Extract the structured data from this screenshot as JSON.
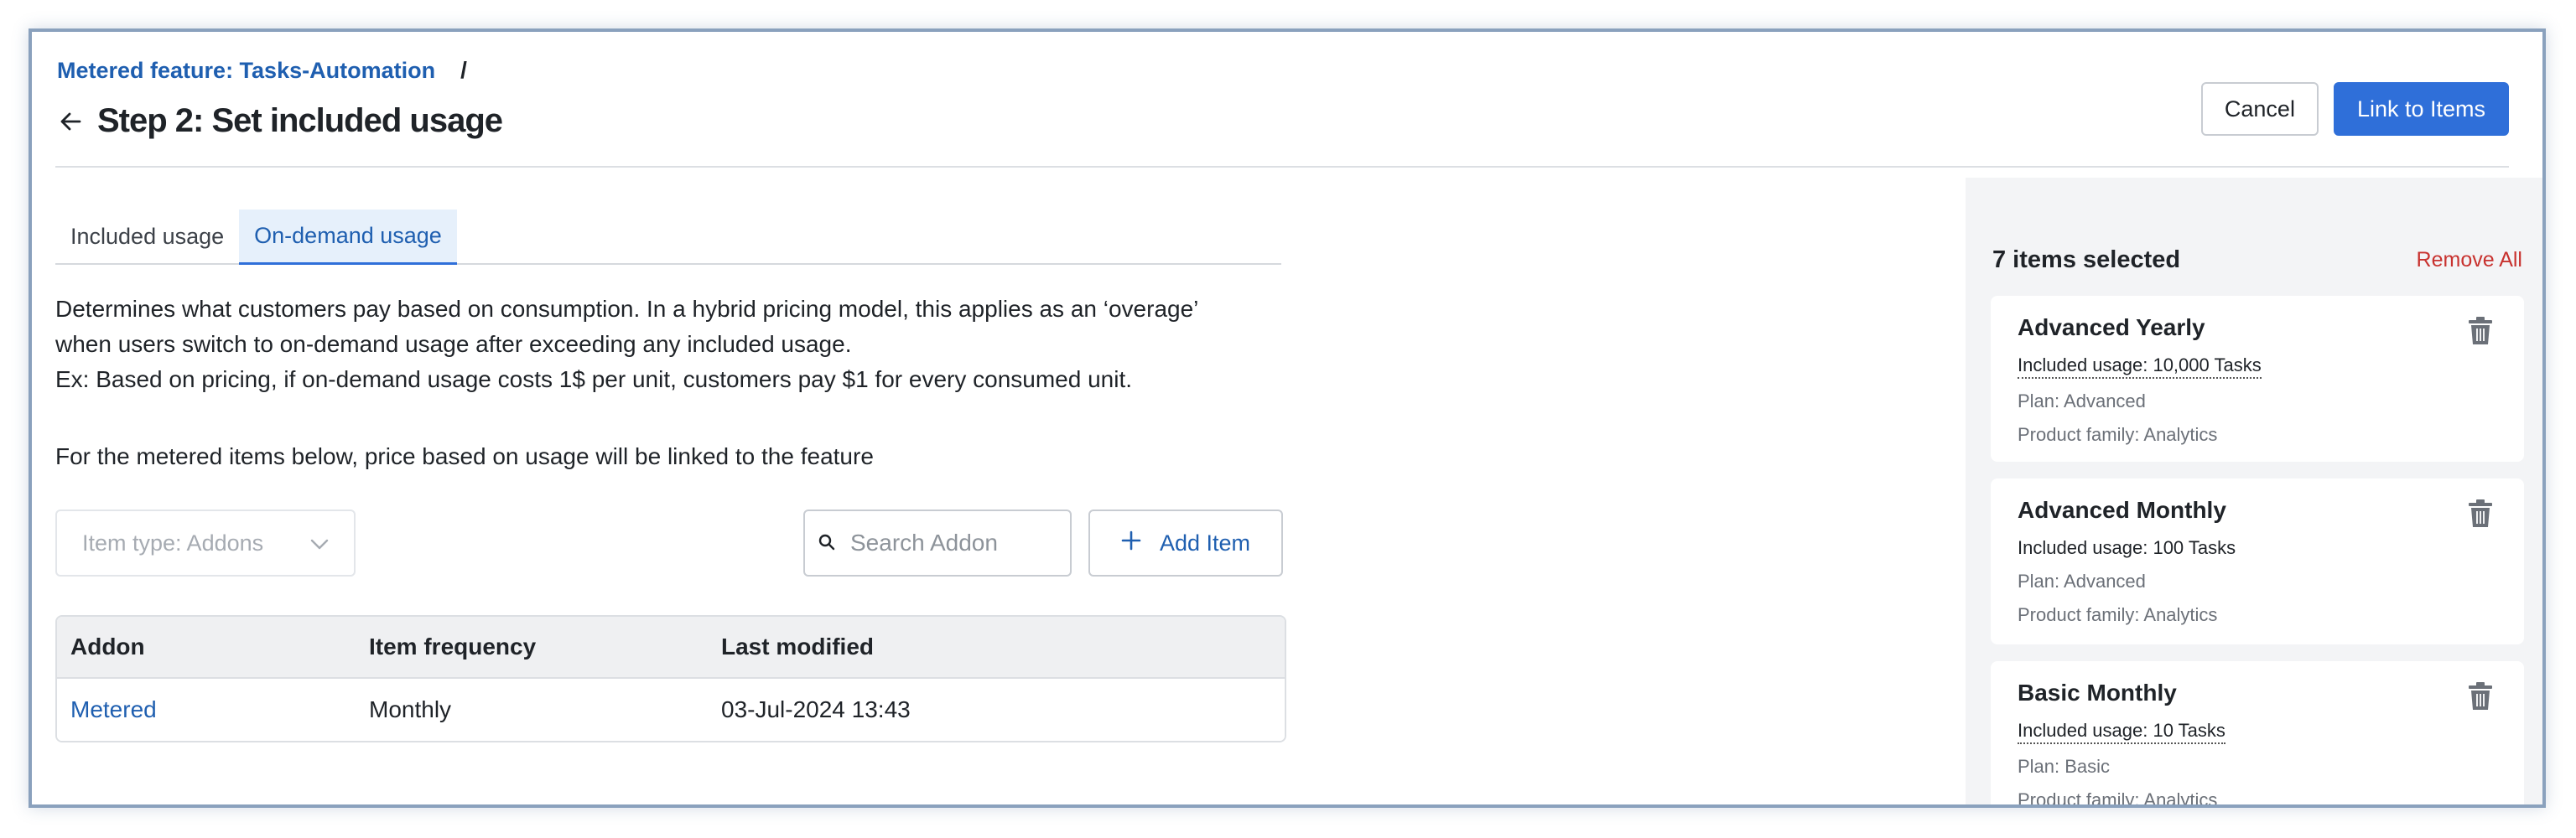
{
  "breadcrumb": {
    "link": "Metered feature: Tasks-Automation",
    "separator": "/"
  },
  "page_title": "Step 2: Set included usage",
  "actions": {
    "cancel": "Cancel",
    "primary": "Link to Items"
  },
  "tabs": [
    {
      "label": "Included usage",
      "active": false
    },
    {
      "label": "On-demand usage",
      "active": true
    }
  ],
  "description": {
    "line1": "Determines what customers pay based on consumption. In a hybrid pricing model, this applies as an ‘overage’",
    "line2": "when users switch to on-demand usage after exceeding any included usage.",
    "line3": "Ex: Based on pricing, if on-demand usage costs 1$ per unit, customers pay $1 for every consumed unit.",
    "line4": "For the metered items below, price based on usage will be linked to the feature"
  },
  "filters": {
    "item_type": "Item type: Addons",
    "search_placeholder": "Search Addon",
    "add_item": "Add Item"
  },
  "table": {
    "headers": [
      "Addon",
      "Item frequency",
      "Last modified"
    ],
    "rows": [
      {
        "addon": "Metered",
        "frequency": "Monthly",
        "modified": "03-Jul-2024 13:43"
      }
    ]
  },
  "selection": {
    "title": "7 items selected",
    "remove_all": "Remove All",
    "items": [
      {
        "name": "Advanced Yearly",
        "usage": "Included usage: 10,000 Tasks",
        "plan": "Plan: Advanced",
        "family": "Product family: Analytics"
      },
      {
        "name": "Advanced Monthly",
        "usage": "Included usage: 100 Tasks",
        "plan": "Plan: Advanced",
        "family": "Product family: Analytics"
      },
      {
        "name": "Basic Monthly",
        "usage": "Included usage: 10 Tasks",
        "plan": "Plan: Basic",
        "family": "Product family: Analytics"
      }
    ]
  },
  "colors": {
    "accent": "#2f6fd9",
    "link": "#1f5fb0",
    "danger": "#c8322f",
    "panel": "#f3f4f6"
  }
}
